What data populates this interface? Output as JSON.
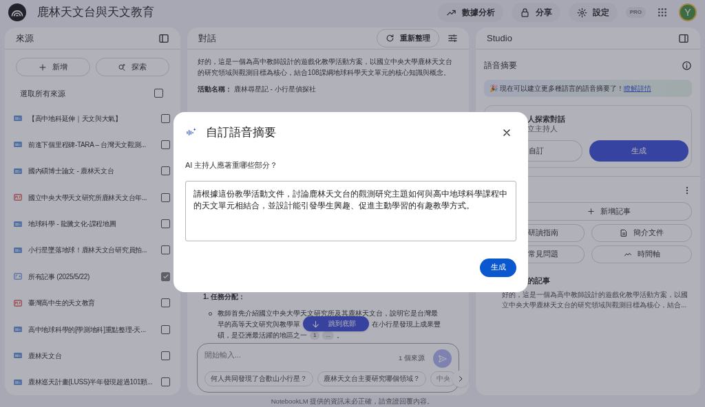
{
  "header": {
    "title": "鹿林天文台與天文教育",
    "buttons": [
      {
        "kind": "analytics",
        "label": "數據分析"
      },
      {
        "kind": "share",
        "label": "分享"
      },
      {
        "kind": "settings",
        "label": "設定"
      }
    ],
    "badge": "PRO",
    "avatar": "Y"
  },
  "sources": {
    "title": "來源",
    "add_button": "新增",
    "explore_button": "探索",
    "select_all": {
      "label": "選取所有來源",
      "checked": false
    },
    "items": [
      {
        "kind": "doc",
        "title": "【高中地科延伸｜天文與大氣】",
        "checked": false
      },
      {
        "kind": "doc",
        "title": "前進下個里程碑-TARA – 台灣天文觀測...",
        "checked": false
      },
      {
        "kind": "doc",
        "title": "國內碩博士論文 - 鹿林天文台",
        "checked": false
      },
      {
        "kind": "pdf",
        "title": "國立中央大學天文研究所鹿林天文台年...",
        "checked": false
      },
      {
        "kind": "doc",
        "title": "地球科學 - 龍騰文化-課程地圖",
        "checked": false
      },
      {
        "kind": "doc",
        "title": "小行星墜落地球！鹿林天文台研究員拍...",
        "checked": false
      },
      {
        "kind": "note",
        "title": "所有記事 (2025/5/22)",
        "checked": true
      },
      {
        "kind": "pdf",
        "title": "臺灣高中生的天文教育",
        "checked": false
      },
      {
        "kind": "doc",
        "title": "高中地球科學的[學測地科]重點整理-天...",
        "checked": false
      },
      {
        "kind": "doc",
        "title": "鹿林天文台",
        "checked": false
      },
      {
        "kind": "doc",
        "title": "鹿林巡天計畫(LUSS)半年發現超過101顆...",
        "checked": false
      }
    ]
  },
  "chat": {
    "title": "對話",
    "refresh_button": "重新整理",
    "intro": "好的，這是一個為高中教師設計的遊戲化教學活動方案，以國立中央大學鹿林天文台的研究領域與觀測目標為核心，結合108課綱地球科學天文單元的核心知識與概念。",
    "activity": "**活動名稱：** 鹿林尋星記 - 小行星偵探社",
    "section_heading": "1. 任務分配：",
    "bullet_lines": [
      "教師首先介紹國立中央大學天文研究所及其鹿林天文台，說明它是台灣最",
      "早的高等天文研究與教學單",
      "在小行星發現上成果豐",
      "碩，是亞洲最活躍的地區之一"
    ],
    "citations": [
      "1",
      "..."
    ],
    "bullet_end": "。",
    "jump_button": "跳到底部",
    "input": {
      "placeholder": "開始輸入...",
      "source_count": "1 個來源"
    },
    "suggestions": [
      {
        "text": "何人共同發現了合歡山小行星？",
        "faded": false
      },
      {
        "text": "鹿林天文台主要研究哪個領域？",
        "faded": false
      },
      {
        "text": "中央",
        "faded": true
      }
    ],
    "disclaimer": "NotebookLM 提供的資訊未必正確，請查證回覆內容。"
  },
  "studio": {
    "title": "Studio",
    "audio_title": "語音摘要",
    "banner": "🎉 現在可以建立更多種語言的語音摘要了！",
    "banner_link": "瞭解詳情",
    "card_title": "人探索對話",
    "card_subtitle": "立主持人",
    "customize_button": "自訂",
    "generate_button": "生成",
    "add_note_button": "新增記事",
    "tools": [
      {
        "kind": "guide",
        "label": "研讀指南"
      },
      {
        "kind": "brief",
        "label": "簡介文件"
      },
      {
        "kind": "faq",
        "label": "常見問題"
      },
      {
        "kind": "timeline",
        "label": "時間軸"
      }
    ],
    "note_title": "的記事",
    "note_text": "好的，這是一個為高中教師設計的遊戲化教學活動方案，以國立中央大學鹿林天文台的研究領域與觀測目標為核心，結合..."
  },
  "dialog": {
    "title": "自訂語音摘要",
    "question": "AI 主持人應著重哪些部分？",
    "value": "請根據這份教學活動文件，討論鹿林天文台的觀測研究主題如何與高中地球科學課程中的天文單元相結合，並設計能引發學生興趣、促進主動學習的有趣教學方式。",
    "submit": "生成"
  }
}
